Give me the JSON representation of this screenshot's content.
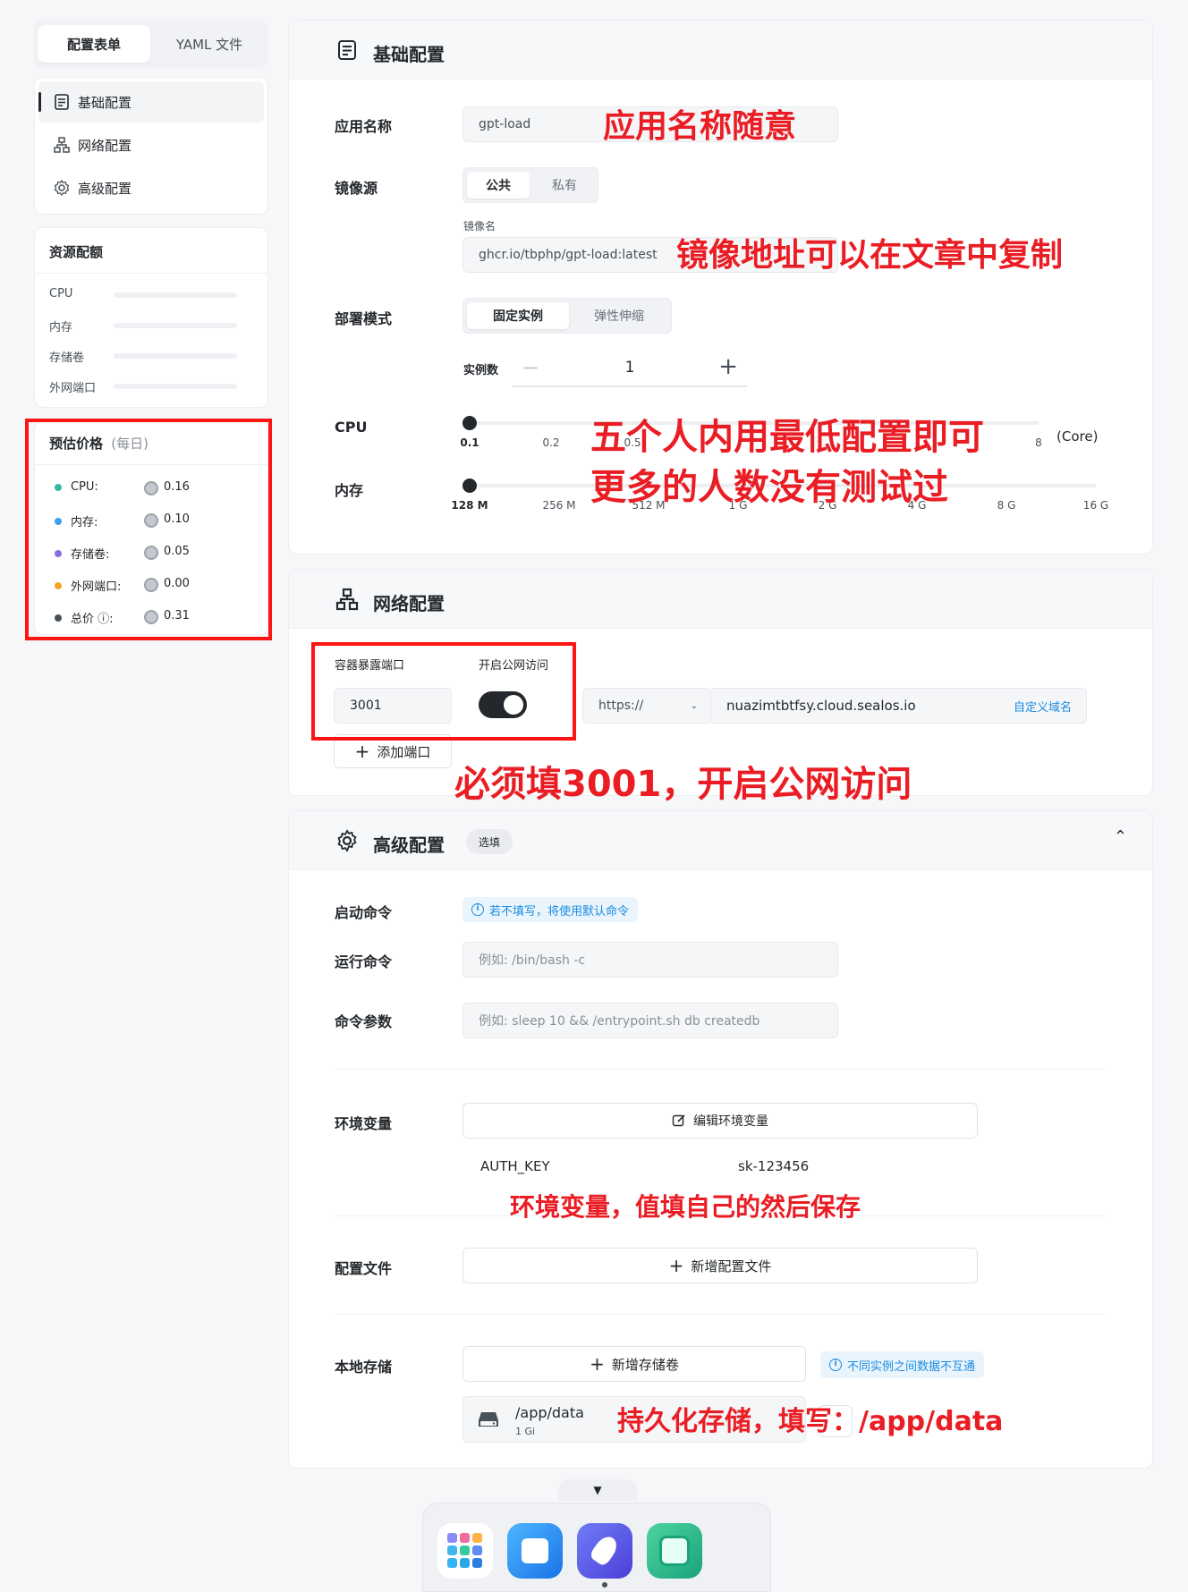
{
  "sidebar": {
    "tabs": [
      "配置表单",
      "YAML 文件"
    ],
    "nav": [
      "基础配置",
      "网络配置",
      "高级配置"
    ],
    "quota_title": "资源配额",
    "quota_items": [
      "CPU",
      "内存",
      "存储卷",
      "外网端口"
    ],
    "price_title": "预估价格",
    "price_period": "(每日)",
    "prices": [
      {
        "label": "CPU:",
        "value": "0.16",
        "color": "#34b8a4"
      },
      {
        "label": "内存:",
        "value": "0.10",
        "color": "#3aa0f0"
      },
      {
        "label": "存储卷:",
        "value": "0.05",
        "color": "#8a6ee0"
      },
      {
        "label": "外网端口:",
        "value": "0.00",
        "color": "#f5a524"
      },
      {
        "label": "总价 ⓘ:",
        "value": "0.31",
        "color": "#485058"
      }
    ]
  },
  "basic": {
    "title": "基础配置",
    "app_name_label": "应用名称",
    "app_name_value": "gpt-load",
    "image_source_label": "镜像源",
    "image_source_options": [
      "公共",
      "私有"
    ],
    "image_name_label": "镜像名",
    "image_name_value": "ghcr.io/tbphp/gpt-load:latest",
    "deploy_mode_label": "部署模式",
    "deploy_mode_options": [
      "固定实例",
      "弹性伸缩"
    ],
    "instances_label": "实例数",
    "instances_value": "1",
    "cpu_label": "CPU",
    "cpu_ticks": [
      "0.1",
      "0.2",
      "0.5",
      "8"
    ],
    "cpu_unit": "(Core)",
    "mem_label": "内存",
    "mem_ticks": [
      "128 M",
      "256 M",
      "512 M",
      "1 G",
      "2 G",
      "4 G",
      "8 G",
      "16 G"
    ]
  },
  "network": {
    "title": "网络配置",
    "port_label": "容器暴露端口",
    "public_label": "开启公网访问",
    "port_value": "3001",
    "public_enabled": true,
    "protocol": "https://",
    "domain": "nuazimtbtfsy.cloud.sealos.io",
    "custom_domain": "自定义域名",
    "add_port": "添加端口"
  },
  "advanced": {
    "title": "高级配置",
    "optional_badge": "选填",
    "startup_label": "启动命令",
    "startup_hint": "若不填写，将使用默认命令",
    "run_label": "运行命令",
    "run_placeholder": "例如: /bin/bash -c",
    "args_label": "命令参数",
    "args_placeholder": "例如: sleep 10 && /entrypoint.sh db createdb",
    "env_label": "环境变量",
    "env_button": "编辑环境变量",
    "env_key": "AUTH_KEY",
    "env_value": "sk-123456",
    "config_label": "配置文件",
    "config_button": "新增配置文件",
    "storage_label": "本地存储",
    "storage_button": "新增存储卷",
    "storage_hint": "不同实例之间数据不互通",
    "volume_path": "/app/data",
    "volume_size": "1 Gi"
  },
  "annotations": {
    "app_name": "应用名称随意",
    "image": "镜像地址可以在文章中复制",
    "resource_line1": "五个人内用最低配置即可",
    "resource_line2": "更多的人数没有测试过",
    "port": "必须填3001，开启公网访问",
    "env": "环境变量，值填自己的然后保存",
    "storage": "持久化存储，填写：/app/data"
  },
  "dock": {
    "apps": [
      "app-grid-icon",
      "store-icon",
      "launchpad-icon",
      "database-icon"
    ]
  },
  "colors": {
    "annotation_red": "#ea1d24",
    "accent_blue": "#1b8ce0",
    "dark": "#24282c"
  }
}
